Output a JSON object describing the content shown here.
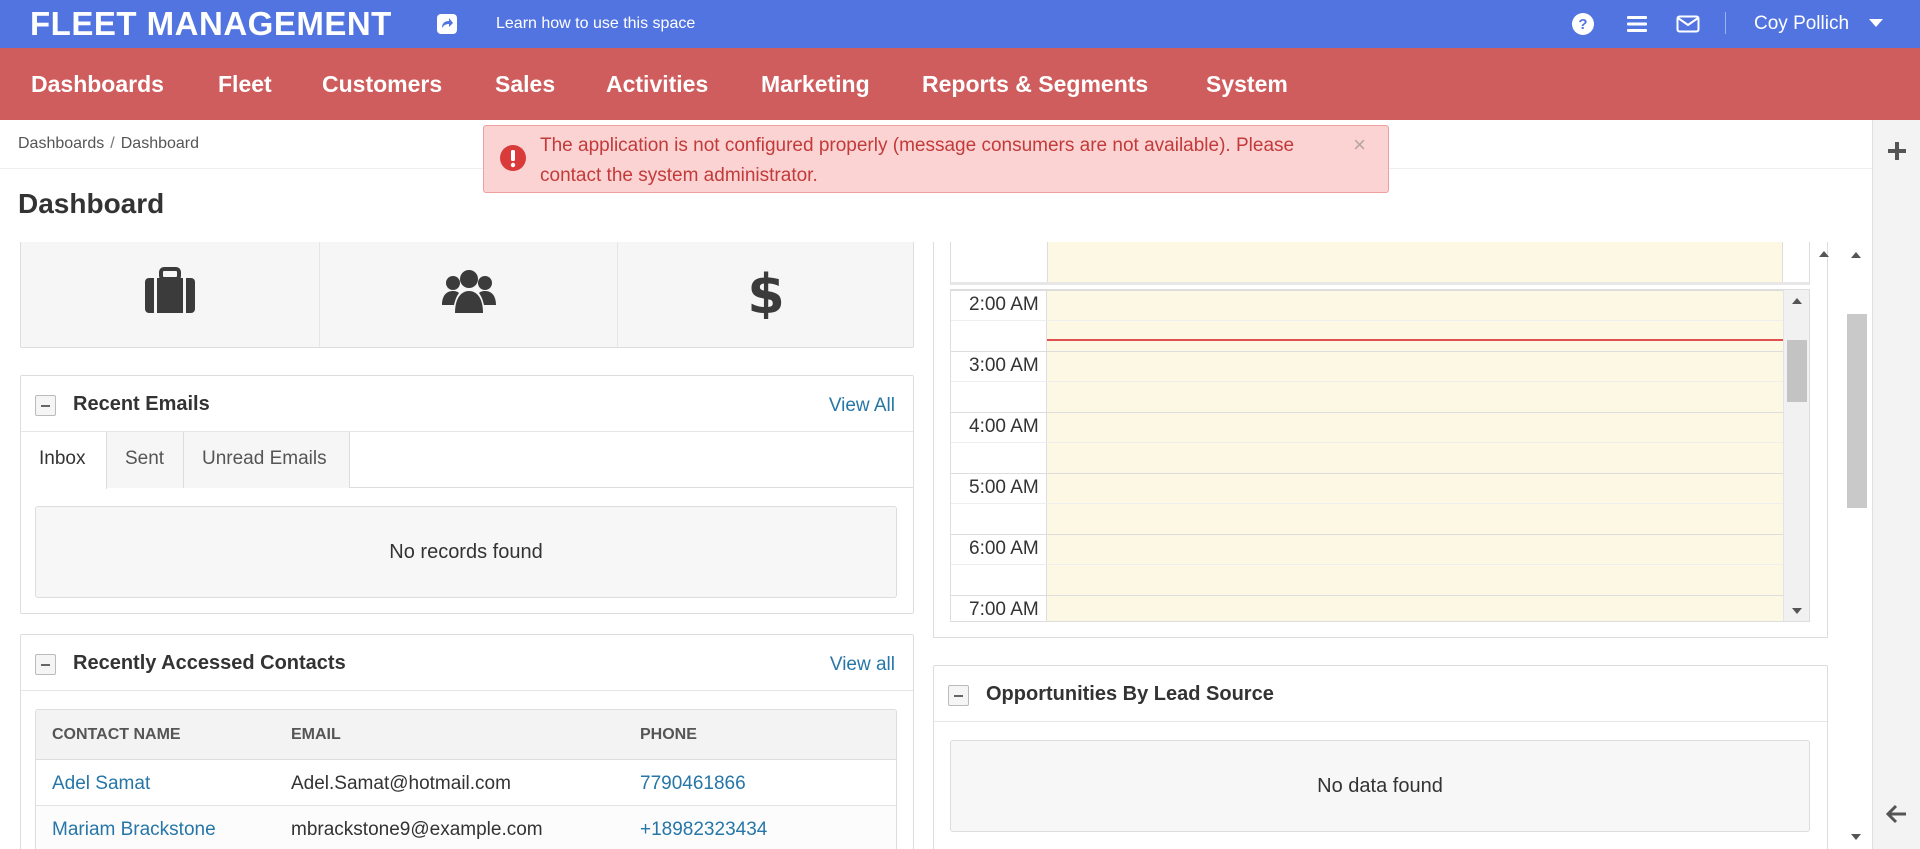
{
  "topbar": {
    "brand": "FLEET MANAGEMENT",
    "learn_link": "Learn how to use this space",
    "user_name": "Coy Pollich",
    "colors": {
      "topbar_bg": "#5174e0",
      "nav_bg": "#cf5d5d"
    },
    "icons": [
      "share-icon",
      "help-icon",
      "menu-icon",
      "mail-icon",
      "caret-down-icon"
    ]
  },
  "nav": {
    "items": [
      "Dashboards",
      "Fleet",
      "Customers",
      "Sales",
      "Activities",
      "Marketing",
      "Reports & Segments",
      "System"
    ]
  },
  "breadcrumb": {
    "items": [
      "Dashboards",
      "Dashboard"
    ],
    "separator": "/"
  },
  "page": {
    "title": "Dashboard"
  },
  "alert": {
    "message": "The application is not configured properly (message consumers are not available). Please contact the system administrator.",
    "close": "×"
  },
  "quick_launch": {
    "icons": [
      "briefcase-icon",
      "users-icon",
      "dollar-icon"
    ]
  },
  "recent_emails": {
    "title": "Recent Emails",
    "view_all": "View All",
    "tabs": [
      "Inbox",
      "Sent",
      "Unread Emails"
    ],
    "active_tab": "Inbox",
    "empty": "No records found"
  },
  "recent_contacts": {
    "title": "Recently Accessed Contacts",
    "view_all": "View all",
    "columns": [
      "CONTACT NAME",
      "EMAIL",
      "PHONE"
    ],
    "rows": [
      {
        "name": "Adel Samat",
        "email": "Adel.Samat@hotmail.com",
        "phone": "7790461866"
      },
      {
        "name": "Mariam Brackstone",
        "email": "mbrackstone9@example.com",
        "phone": "+18982323434"
      }
    ]
  },
  "calendar": {
    "times": [
      "2:00 AM",
      "3:00 AM",
      "4:00 AM",
      "5:00 AM",
      "6:00 AM",
      "7:00 AM"
    ],
    "colors": {
      "day_bg": "#fcf8e3",
      "now_line": "#e05050"
    }
  },
  "opportunities": {
    "title": "Opportunities By Lead Source",
    "empty": "No data found"
  },
  "right_rail": {
    "icons": [
      "plus-icon",
      "arrow-left-icon"
    ]
  }
}
